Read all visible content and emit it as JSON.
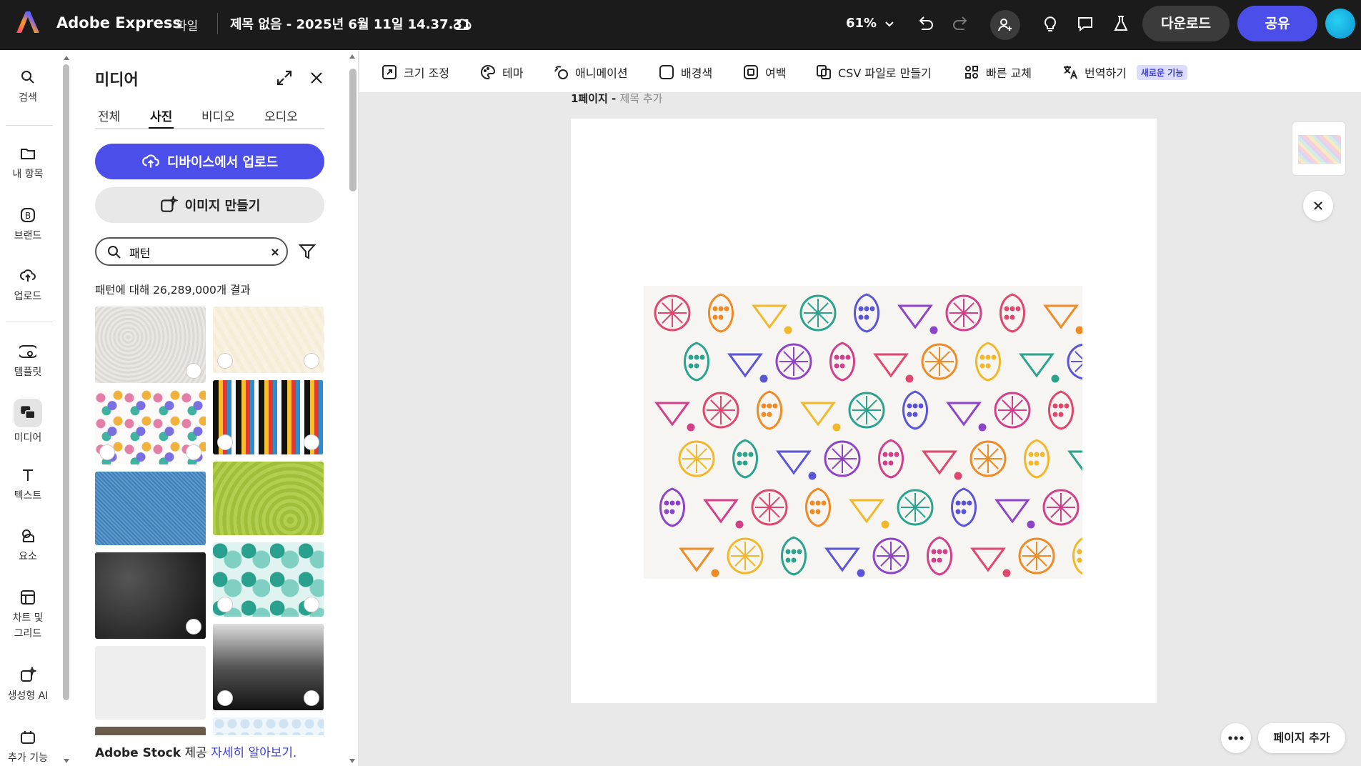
{
  "app": {
    "name": "Adobe Express",
    "file_menu": "파일",
    "document_title": "제목 없음 - 2025년 6월 11일 14.37.31"
  },
  "topbar": {
    "zoom": "61%",
    "download_label": "다운로드",
    "share_label": "공유"
  },
  "rail": {
    "items": [
      {
        "label": "검색",
        "icon": "search-icon"
      },
      {
        "label": "내 항목",
        "icon": "folder-icon"
      },
      {
        "label": "브랜드",
        "icon": "brand-icon"
      },
      {
        "label": "업로드",
        "icon": "upload-icon"
      },
      {
        "label": "템플릿",
        "icon": "template-icon"
      },
      {
        "label": "미디어",
        "icon": "media-icon",
        "active": true
      },
      {
        "label": "텍스트",
        "icon": "text-icon"
      },
      {
        "label": "요소",
        "icon": "elements-icon"
      },
      {
        "label": "차트 및 그리드",
        "icon": "chart-grid-icon"
      },
      {
        "label": "생성형 AI",
        "icon": "generative-ai-icon"
      },
      {
        "label": "추가 기능",
        "icon": "addons-icon"
      }
    ]
  },
  "panel": {
    "title": "미디어",
    "tabs": [
      "전체",
      "사진",
      "비디오",
      "오디오"
    ],
    "active_tab": "사진",
    "upload_label": "디바이스에서 업로드",
    "generate_label": "이미지 만들기",
    "search_value": "패턴",
    "results_text": "패턴에 대해 26,289,000개 결과",
    "credit_brand": "Adobe Stock",
    "credit_suffix": " 제공 ",
    "credit_link": "자세히 알아보기."
  },
  "toolbar": {
    "items": [
      {
        "label": "크기 조정",
        "icon": "resize-icon"
      },
      {
        "label": "테마",
        "icon": "palette-icon"
      },
      {
        "label": "애니메이션",
        "icon": "animation-icon"
      },
      {
        "label": "배경색",
        "icon": "background-color-icon"
      },
      {
        "label": "여백",
        "icon": "padding-icon"
      },
      {
        "label": "CSV 파일로 만들기",
        "icon": "csv-icon"
      },
      {
        "label": "빠른 교체",
        "icon": "quick-swap-icon"
      },
      {
        "label": "번역하기",
        "icon": "translate-icon"
      }
    ],
    "new_badge": "새로운 기능"
  },
  "canvas": {
    "page_label": "1페이지 - ",
    "page_subtitle": "제목 추가",
    "add_page_label": "페이지 추가"
  },
  "colors": {
    "accent": "#4b4ee8",
    "topbar": "#1b1b1b",
    "canvas_bg": "#e9e9e9"
  }
}
